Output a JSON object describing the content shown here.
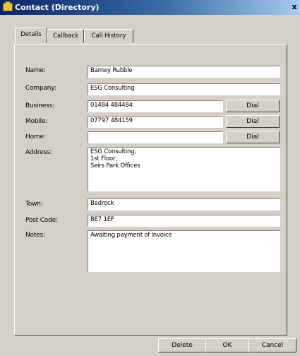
{
  "window": {
    "title": "Contact (Directory)",
    "close_glyph": "x",
    "icon": "folder-icon"
  },
  "tabs": [
    {
      "label": "Details",
      "active": true
    },
    {
      "label": "Callback",
      "active": false
    },
    {
      "label": "Call History",
      "active": false
    }
  ],
  "labels": {
    "name": "Name:",
    "company": "Company:",
    "business": "Business:",
    "mobile": "Mobile:",
    "home": "Home:",
    "address": "Address:",
    "town": "Town:",
    "postcode": "Post Code:",
    "notes": "Notes:"
  },
  "values": {
    "name": "Barney Rubble",
    "company": "ESG Consulting",
    "business": "01484 484484",
    "mobile": "07797 484159",
    "home": "",
    "address": "ESG Consulting,\n1st Floor,\nSeirs Park Offices",
    "town": "Bedrock",
    "postcode": "BE7 1EF",
    "notes": "Awaiting payment of invoice"
  },
  "buttons": {
    "dial_business": "Dial",
    "dial_mobile": "Dial",
    "dial_home": "Dial",
    "delete": "Delete",
    "ok": "OK",
    "cancel": "Cancel"
  }
}
